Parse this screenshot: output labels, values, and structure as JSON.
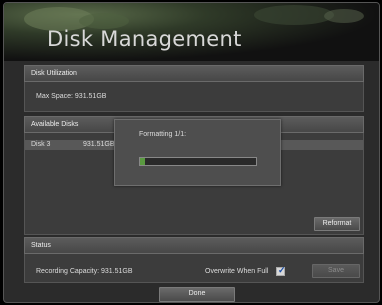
{
  "window": {
    "title": "Disk Management"
  },
  "disk_utilization": {
    "header": "Disk Utilization",
    "max_space": "Max Space: 931.51GB"
  },
  "available_disks": {
    "header": "Available Disks",
    "rows": [
      {
        "name": "Disk 3",
        "size": "931.51GB"
      }
    ],
    "reformat_label": "Reformat"
  },
  "formatting_dialog": {
    "label": "Formatting 1/1:",
    "progress": 0.04
  },
  "status": {
    "header": "Status",
    "recording_capacity": "Recording Capacity: 931.51GB",
    "overwrite_label": "Overwrite When Full",
    "overwrite_checked": true,
    "save_label": "Save"
  },
  "footer": {
    "done_label": "Done"
  },
  "colors": {
    "progress_fill": "#5a9a40",
    "checkmark": "#1a4ea8"
  }
}
